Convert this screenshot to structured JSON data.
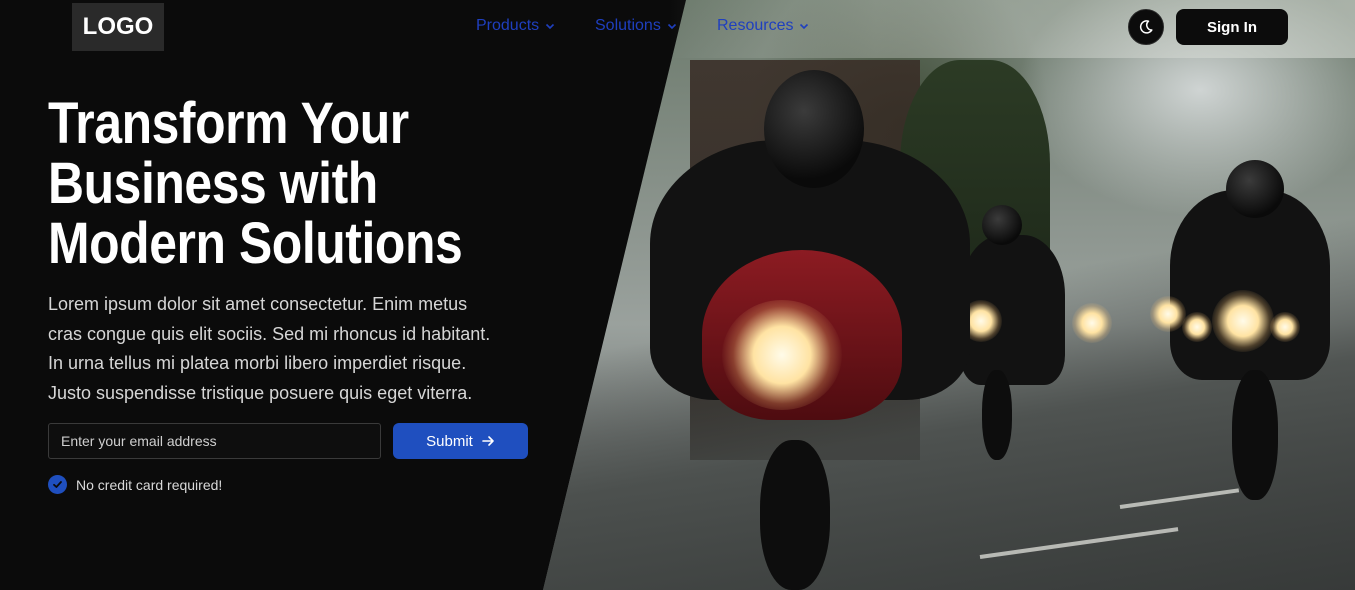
{
  "header": {
    "logo": "LOGO",
    "nav": [
      {
        "label": "Products"
      },
      {
        "label": "Solutions"
      },
      {
        "label": "Resources"
      }
    ],
    "theme_toggle_icon": "moon-icon",
    "sign_in_label": "Sign In"
  },
  "hero": {
    "headline_lines": [
      "Transform Your",
      "Business with",
      "Modern Solutions"
    ],
    "lead_lines": [
      "Lorem ipsum dolor sit amet consectetur. Enim metus",
      "cras congue quis elit sociis. Sed mi rhoncus id habitant.",
      "In urna tellus mi platea morbi libero imperdiet risque.",
      "Justo suspendisse tristique posuere quis eget viterra."
    ],
    "email_placeholder": "Enter your email address",
    "submit_label": "Submit",
    "submit_icon": "arrow-right-icon",
    "note": "No credit card required!",
    "note_icon": "check-circle-icon"
  },
  "colors": {
    "accent": "#1f4fbf",
    "background": "#0b0b0b",
    "nav_link": "#1f3fbf"
  }
}
